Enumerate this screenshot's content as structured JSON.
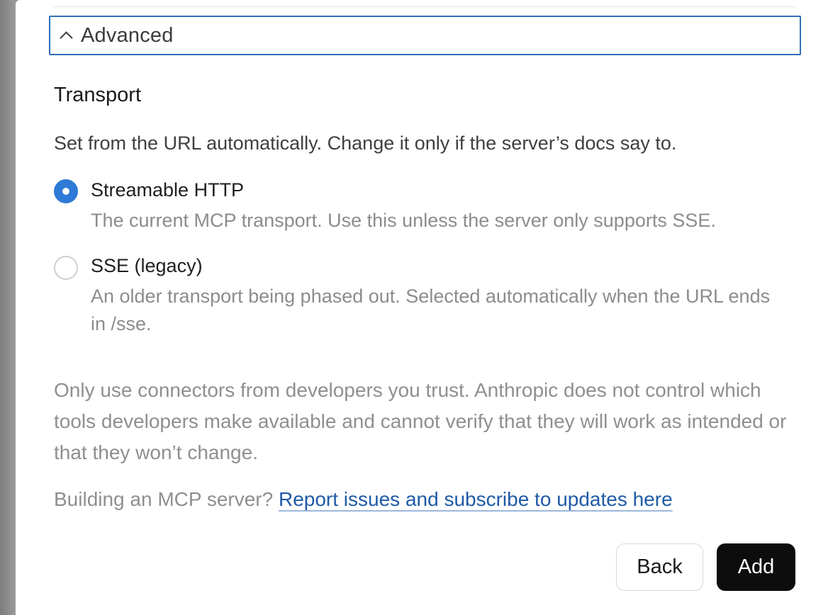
{
  "advanced": {
    "label": "Advanced",
    "expanded": true
  },
  "transport": {
    "title": "Transport",
    "description": "Set from the URL automatically. Change it only if the server’s docs say to.",
    "options": [
      {
        "label": "Streamable HTTP",
        "description": "The current MCP transport. Use this unless the server only supports SSE.",
        "selected": true
      },
      {
        "label": "SSE (legacy)",
        "description": "An older transport being phased out. Selected automatically when the URL ends in /sse.",
        "selected": false
      }
    ]
  },
  "disclaimer": "Only use connectors from developers you trust. Anthropic does not control which tools developers make available and cannot verify that they will work as intended or that they won’t change.",
  "building": {
    "prefix": "Building an MCP server?",
    "link_text": "Report issues and subscribe to updates here"
  },
  "buttons": {
    "back": "Back",
    "add": "Add"
  },
  "colors": {
    "accent_blue": "#2e7ad6",
    "link_blue": "#1f5aa6",
    "focus_border": "#2f6fb5",
    "primary_button": "#0d0d0d"
  }
}
